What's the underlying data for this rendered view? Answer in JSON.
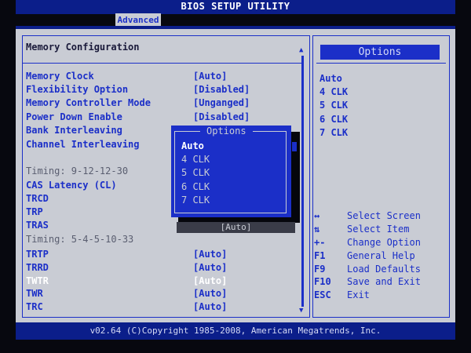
{
  "header": {
    "title": "BIOS SETUP UTILITY",
    "active_tab": "Advanced"
  },
  "section": {
    "title": "Memory Configuration"
  },
  "settings": [
    {
      "label": "Memory Clock",
      "value": "[Auto]"
    },
    {
      "label": "Flexibility Option",
      "value": "[Disabled]"
    },
    {
      "label": "Memory Controller Mode",
      "value": "[Unganged]"
    },
    {
      "label": "Power Down Enable",
      "value": "[Disabled]"
    },
    {
      "label": "Bank Interleaving",
      "value": ""
    },
    {
      "label": "Channel Interleaving",
      "value": ""
    },
    {
      "label": "Timing: 9-12-12-30",
      "value": ""
    },
    {
      "label": "CAS Latency (CL)",
      "value": ""
    },
    {
      "label": "TRCD",
      "value": ""
    },
    {
      "label": "TRP",
      "value": ""
    },
    {
      "label": "TRAS",
      "value": "[Auto]"
    },
    {
      "label": "Timing: 5-4-5-10-33",
      "value": ""
    },
    {
      "label": "TRTP",
      "value": "[Auto]"
    },
    {
      "label": "TRRD",
      "value": "[Auto]"
    },
    {
      "label": "TWTR",
      "value": "[Auto]"
    },
    {
      "label": "TWR",
      "value": "[Auto]"
    },
    {
      "label": "TRC",
      "value": "[Auto]"
    }
  ],
  "options_panel": {
    "title": "Options",
    "items": [
      "Auto",
      "4 CLK",
      "5 CLK",
      "6 CLK",
      "7 CLK"
    ]
  },
  "popup": {
    "title": "Options",
    "items": [
      "Auto",
      "4 CLK",
      "5 CLK",
      "6 CLK",
      "7 CLK"
    ],
    "selected_index": 0
  },
  "help": [
    {
      "key": "↔",
      "desc": "Select Screen"
    },
    {
      "key": "⇅",
      "desc": "Select Item"
    },
    {
      "key": "+-",
      "desc": "Change Option"
    },
    {
      "key": "F1",
      "desc": "General Help"
    },
    {
      "key": "F9",
      "desc": "Load Defaults"
    },
    {
      "key": "F10",
      "desc": "Save and Exit"
    },
    {
      "key": "ESC",
      "desc": "Exit"
    }
  ],
  "footer": {
    "text": "v02.64 (C)Copyright 1985-2008, American Megatrends, Inc."
  },
  "colors": {
    "bios_blue": "#1b2fc8",
    "panel_gray": "#c9ccd4",
    "header_blue": "#0b1e8a",
    "highlight": "#ffffff"
  }
}
